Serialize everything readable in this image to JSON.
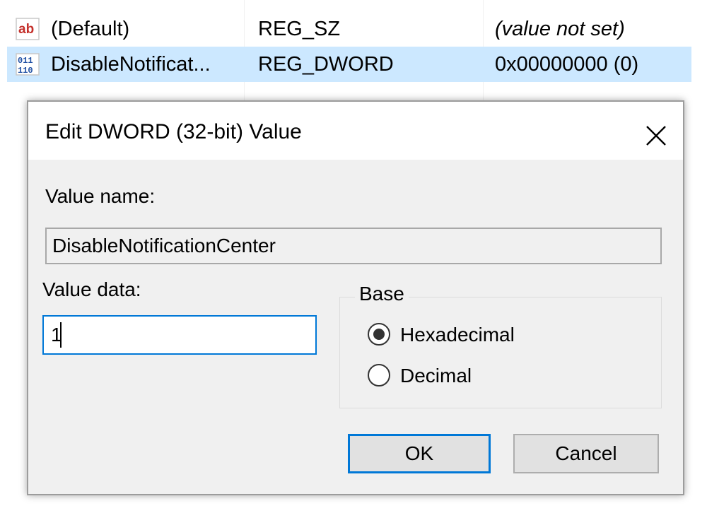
{
  "registry_list": {
    "rows": [
      {
        "icon": "string-value-icon",
        "name": "(Default)",
        "type": "REG_SZ",
        "data": "(value not set)",
        "selected": false
      },
      {
        "icon": "binary-value-icon",
        "name": "DisableNotificat...",
        "type": "REG_DWORD",
        "data": "0x00000000 (0)",
        "selected": true
      }
    ]
  },
  "dialog": {
    "title": "Edit DWORD (32-bit) Value",
    "value_name_label": "Value name:",
    "value_name": "DisableNotificationCenter",
    "value_data_label": "Value data:",
    "value_data": "1",
    "base": {
      "title": "Base",
      "options": [
        {
          "label": "Hexadecimal",
          "selected": true
        },
        {
          "label": "Decimal",
          "selected": false
        }
      ]
    },
    "ok_label": "OK",
    "cancel_label": "Cancel"
  },
  "colors": {
    "selection": "#cce8ff",
    "focus_border": "#0078d7",
    "dialog_bg": "#f0f0f0"
  }
}
